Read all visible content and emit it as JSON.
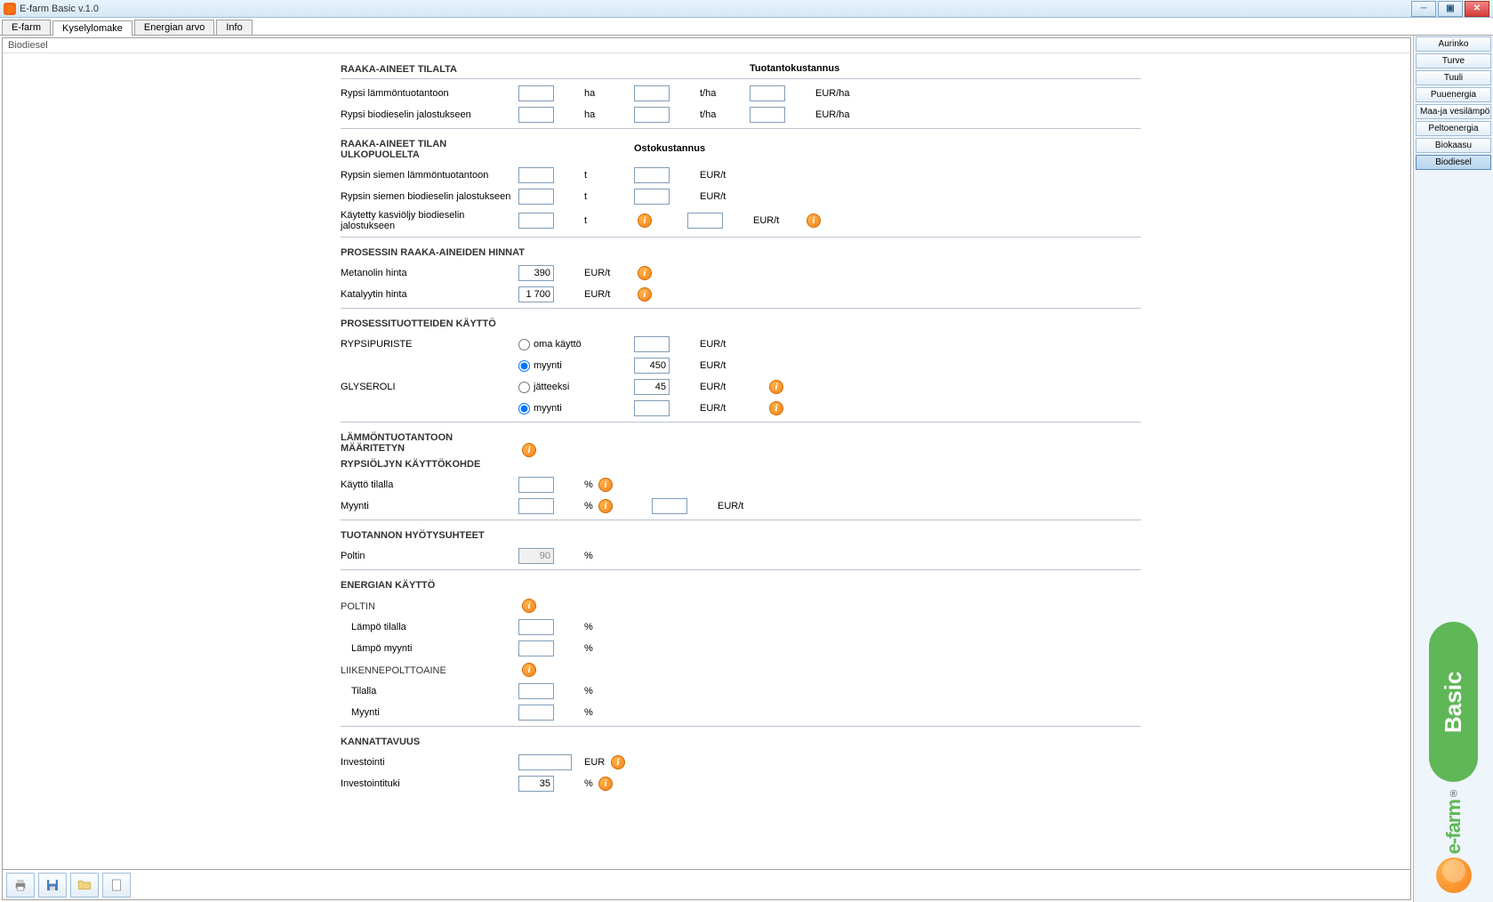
{
  "window": {
    "title": "E-farm Basic v.1.0"
  },
  "tabs": {
    "items": [
      "E-farm",
      "Kyselylomake",
      "Energian arvo",
      "Info"
    ],
    "active_index": 1
  },
  "panel_title": "Biodiesel",
  "sections": {
    "s1_header": "RAAKA-AINEET TILALTA",
    "s1_cost_header": "Tuotantokustannus",
    "s1_r1_label": "Rypsi lämmöntuotantoon",
    "s1_r2_label": "Rypsi biodieselin jalostukseen",
    "unit_ha": "ha",
    "unit_tha": "t/ha",
    "unit_eurha": "EUR/ha",
    "s2_header": "RAAKA-AINEET TILAN ULKOPUOLELTA",
    "s2_cost_header": "Ostokustannus",
    "s2_r1_label": "Rypsin siemen lämmöntuotantoon",
    "s2_r2_label": "Rypsin siemen biodieselin jalostukseen",
    "s2_r3_label": "Käytetty kasviöljy biodieselin jalostukseen",
    "unit_t": "t",
    "unit_eurt": "EUR/t",
    "s3_header": "PROSESSIN RAAKA-AINEIDEN HINNAT",
    "s3_r1_label": "Metanolin hinta",
    "s3_r1_val": "390",
    "s3_r2_label": "Katalyytin hinta",
    "s3_r2_val": "1 700",
    "s4_header": "PROSESSITUOTTEIDEN KÄYTTÖ",
    "s4_r1_label": "RYPSIPURISTE",
    "s4_radio_omakaytto": "oma käyttö",
    "s4_radio_myynti": "myynti",
    "s4_r2_val": "450",
    "s4_r3_label": "GLYSEROLI",
    "s4_radio_jatteeksi": "jätteeksi",
    "s4_r3_val": "45",
    "s5_header1": "LÄMMÖNTUOTANTOON MÄÄRITETYN",
    "s5_header2": "RYPSIÖLJYN KÄYTTÖKOHDE",
    "s5_r1_label": "Käyttö tilalla",
    "s5_r2_label": "Myynti",
    "unit_pct": "%",
    "s6_header": "TUOTANNON HYÖTYSUHTEET",
    "s6_r1_label": "Poltin",
    "s6_r1_val": "90",
    "s7_header": "ENERGIAN KÄYTTÖ",
    "s7_sub1": "POLTIN",
    "s7_r1_label": "Lämpö tilalla",
    "s7_r2_label": "Lämpö myynti",
    "s7_sub2": "LIIKENNEPOLTTOAINE",
    "s7_r3_label": "Tilalla",
    "s7_r4_label": "Myynti",
    "s8_header": "KANNATTAVUUS",
    "s8_r1_label": "Investointi",
    "unit_eur": "EUR",
    "s8_r2_label": "Investointituki",
    "s8_r2_val": "35"
  },
  "categories": {
    "items": [
      "Aurinko",
      "Turve",
      "Tuuli",
      "Puuenergia",
      "Maa-ja vesilämpö",
      "Peltoenergia",
      "Biokaasu",
      "Biodiesel"
    ],
    "selected_index": 7
  },
  "logo": {
    "basic": "Basic",
    "efarm": "e-farm",
    "tm": "®"
  }
}
